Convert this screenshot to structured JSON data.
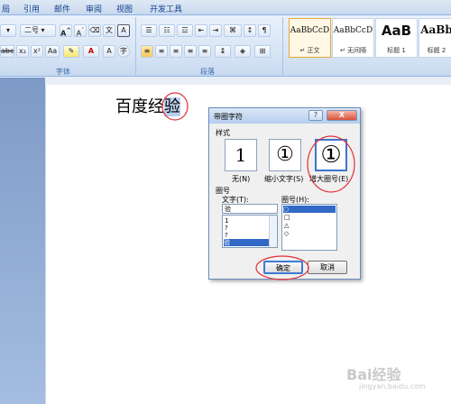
{
  "ribbon_tabs": [
    "局",
    "引用",
    "邮件",
    "审阅",
    "视图",
    "开发工具"
  ],
  "font_group": {
    "font_size": "二号",
    "label": "字体"
  },
  "paragraph_group": {
    "label": "段落"
  },
  "styles": [
    {
      "preview": "AaBbCcD",
      "name": "↵ 正文",
      "selected": true
    },
    {
      "preview": "AaBbCcD",
      "name": "↵ 无间隔",
      "selected": false
    },
    {
      "preview": "AaB",
      "name": "标题 1",
      "selected": false
    },
    {
      "preview": "AaBb",
      "name": "标题 2",
      "selected": false
    }
  ],
  "document": {
    "text_before": "百度经",
    "selected_char": "验"
  },
  "dialog": {
    "title": "带圈字符",
    "help_button": "?",
    "close_button": "X",
    "style_section": "样式",
    "style_options": [
      {
        "glyph": "1",
        "label": "无(N)"
      },
      {
        "glyph": "①",
        "label": "缩小文字(S)"
      },
      {
        "glyph": "①",
        "label": "增大圈号(E)"
      }
    ],
    "circle_section": "圈号",
    "text_label": "文字(T):",
    "text_value": "验",
    "text_items": [
      "1",
      "?",
      "?",
      "验"
    ],
    "ring_label": "圈号(H):",
    "ring_items": [
      "○",
      "□",
      "△",
      "◇"
    ],
    "ok_label": "确定",
    "cancel_label": "取消"
  },
  "watermark": {
    "text": "Bai经验",
    "sub": "jingyan.baidu.com"
  },
  "colors": {
    "highlight": "#b8cfee",
    "list_selection": "#3169c6",
    "annotation_red": "#e0303a"
  }
}
